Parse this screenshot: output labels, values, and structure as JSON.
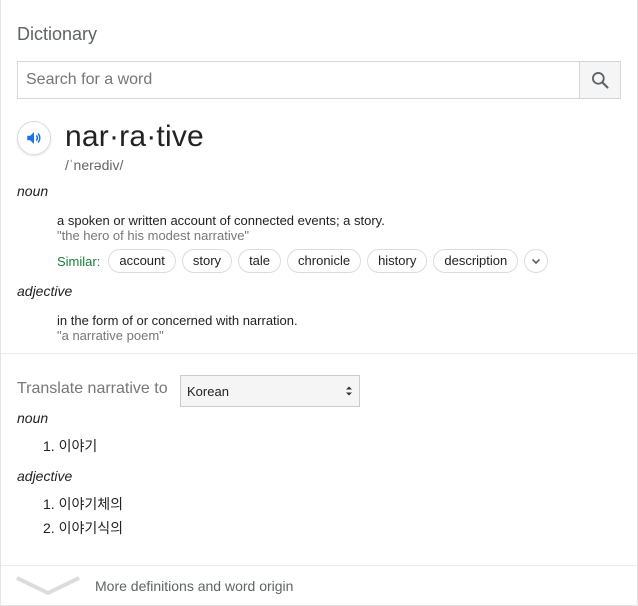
{
  "dictionary": {
    "title": "Dictionary",
    "search": {
      "placeholder": "Search for a word"
    }
  },
  "entry": {
    "word": "nar·ra·tive",
    "phonetic": "/ˈnerədiv/",
    "senses": [
      {
        "pos": "noun",
        "definition": "a spoken or written account of connected events; a story.",
        "example": "\"the hero of his modest narrative\"",
        "similar_label": "Similar:",
        "similar": [
          "account",
          "story",
          "tale",
          "chronicle",
          "history",
          "description"
        ]
      },
      {
        "pos": "adjective",
        "definition": "in the form of or concerned with narration.",
        "example": "\"a narrative poem\""
      }
    ]
  },
  "translate": {
    "label": "Translate narrative to",
    "language": "Korean",
    "groups": [
      {
        "pos": "noun",
        "items": [
          "1. 이야기"
        ]
      },
      {
        "pos": "adjective",
        "items": [
          "1. 이야기체의",
          "2. 이야기식의"
        ]
      }
    ]
  },
  "footer": {
    "more_label": "More definitions and word origin"
  },
  "colors": {
    "accent": "#1a73e8",
    "similar": "#188038"
  }
}
